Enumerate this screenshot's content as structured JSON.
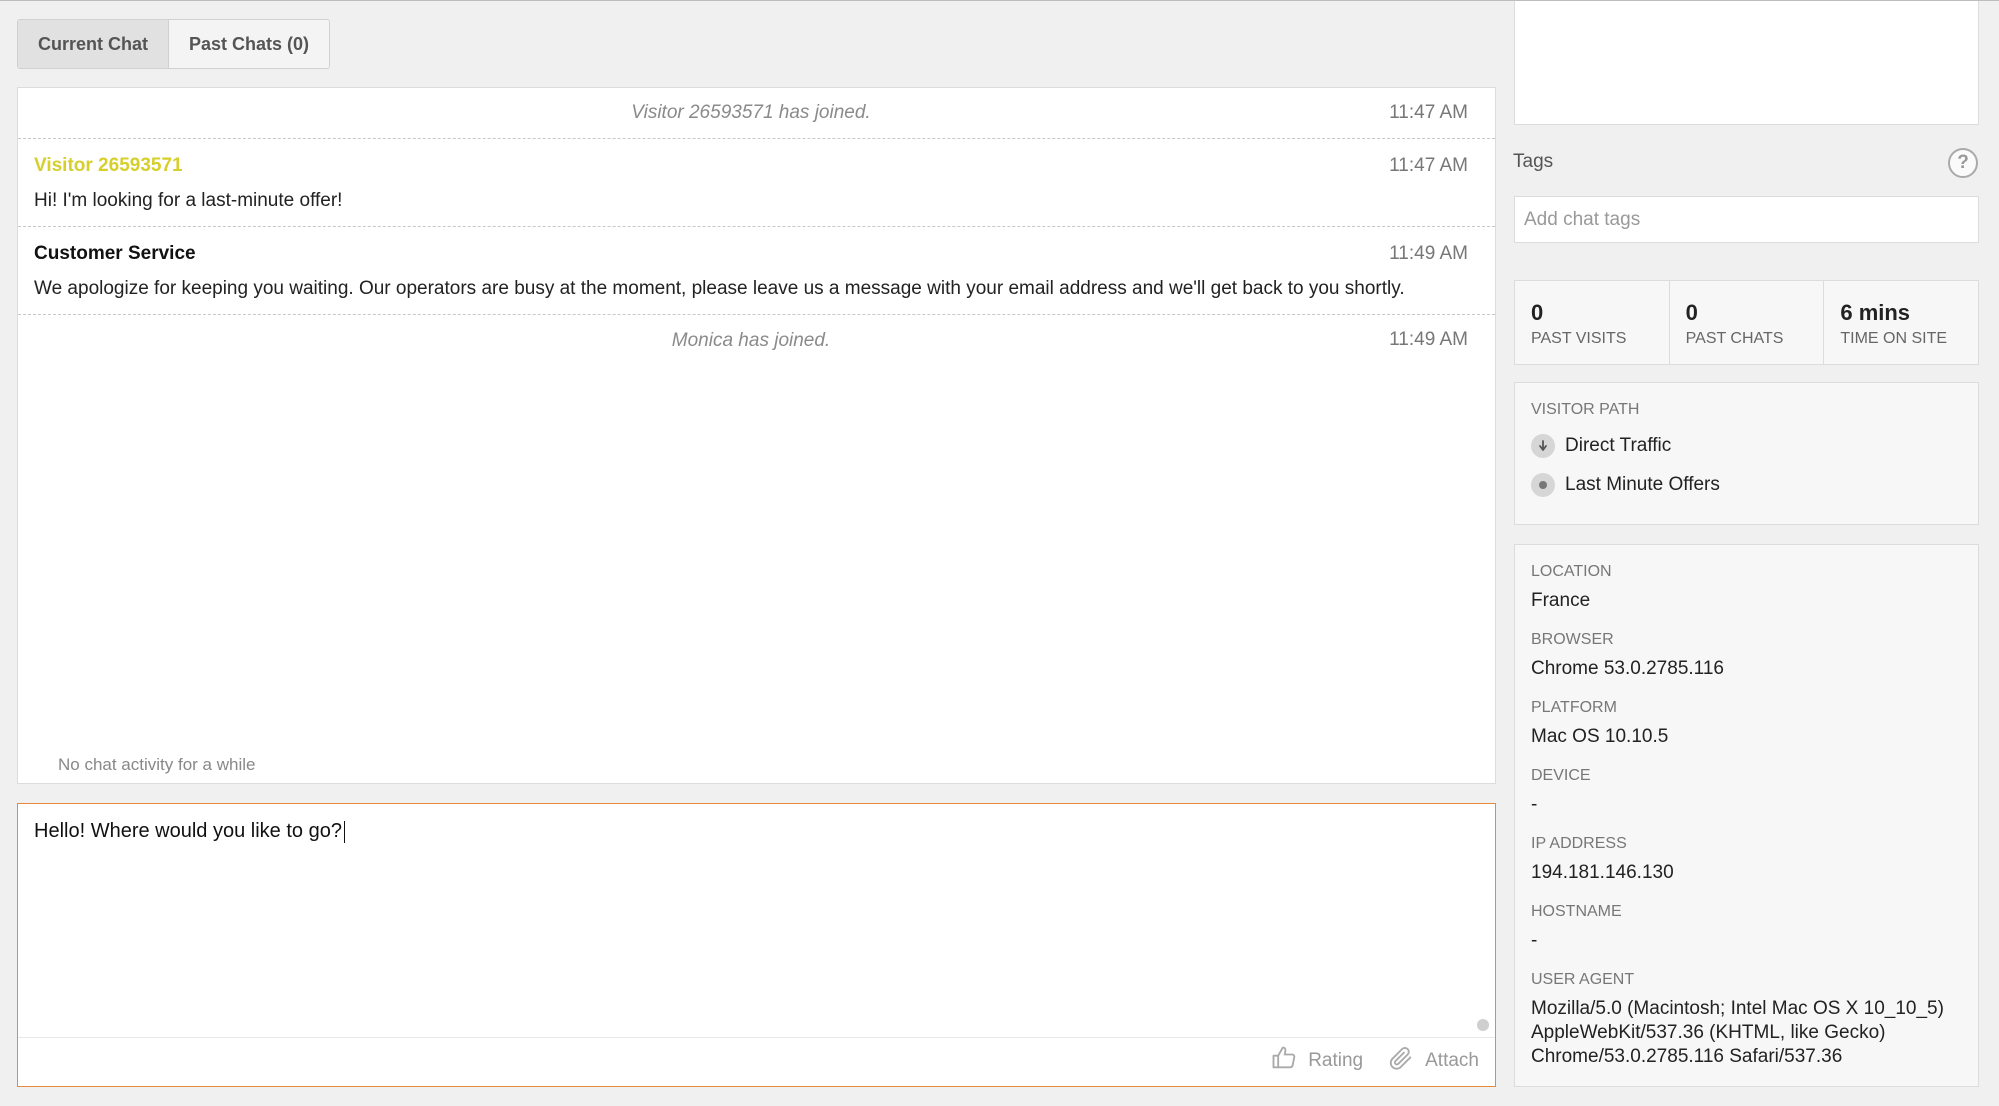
{
  "tabs": [
    {
      "label": "Current Chat",
      "active": true
    },
    {
      "label": "Past Chats (0)",
      "active": false
    }
  ],
  "chat": {
    "messages": [
      {
        "type": "system",
        "text": "Visitor 26593571 has joined.",
        "time": "11:47 AM"
      },
      {
        "type": "visitor",
        "sender": "Visitor 26593571",
        "text": "Hi! I'm looking for a last-minute offer!",
        "time": "11:47 AM"
      },
      {
        "type": "agent",
        "sender": "Customer Service",
        "text": "We apologize for keeping you waiting. Our operators are busy at the moment, please leave us a message with your email address and we'll get back to you shortly.",
        "time": "11:49 AM"
      },
      {
        "type": "system",
        "text": "Monica has joined.",
        "time": "11:49 AM"
      }
    ],
    "idle_note": "No chat activity for a while"
  },
  "composer": {
    "value": "Hello! Where would you like to go?",
    "rating_label": "Rating",
    "attach_label": "Attach"
  },
  "sidebar": {
    "tags_label": "Tags",
    "help_glyph": "?",
    "tags_placeholder": "Add chat tags",
    "stats": [
      {
        "value": "0",
        "label": "PAST VISITS"
      },
      {
        "value": "0",
        "label": "PAST CHATS"
      },
      {
        "value": "6 mins",
        "label": "TIME ON SITE"
      }
    ],
    "visitor_path": {
      "label": "VISITOR PATH",
      "items": [
        "Direct Traffic",
        "Last Minute Offers"
      ]
    },
    "info": [
      {
        "label": "LOCATION",
        "value": "France"
      },
      {
        "label": "BROWSER",
        "value": "Chrome 53.0.2785.116"
      },
      {
        "label": "PLATFORM",
        "value": "Mac OS 10.10.5"
      },
      {
        "label": "DEVICE",
        "value": "-"
      },
      {
        "label": "IP ADDRESS",
        "value": "194.181.146.130"
      },
      {
        "label": "HOSTNAME",
        "value": "-"
      },
      {
        "label": "USER AGENT",
        "value": "Mozilla/5.0 (Macintosh; Intel Mac OS X 10_10_5) AppleWebKit/537.36 (KHTML, like Gecko) Chrome/53.0.2785.116 Safari/537.36"
      }
    ]
  },
  "colors": {
    "visitor_name": "#d6cf2c",
    "composer_border": "#e88a3c"
  },
  "icons": {
    "rating": "thumbs-up-icon",
    "attach": "paperclip-icon",
    "help": "question-circle-icon",
    "path_first": "arrow-down-icon",
    "path_page": "dot-icon"
  }
}
